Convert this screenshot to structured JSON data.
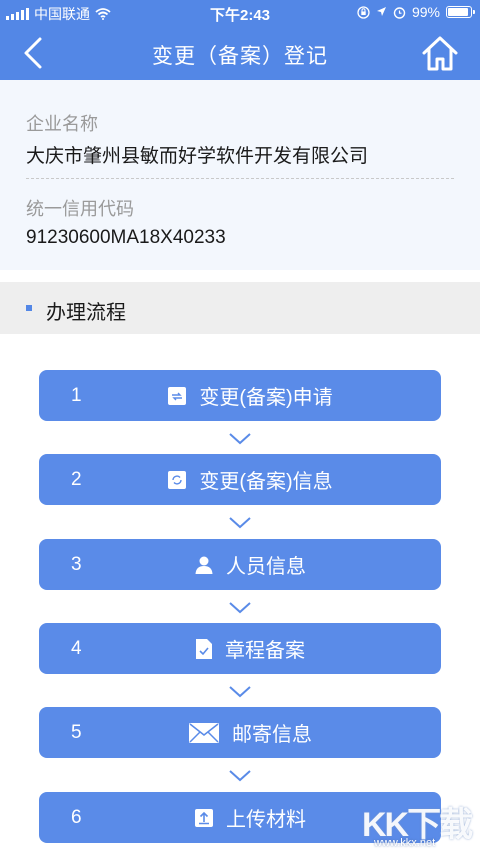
{
  "status_bar": {
    "carrier": "中国联通",
    "time": "下午2:43",
    "battery": "99%"
  },
  "nav": {
    "title": "变更（备案）登记",
    "back_icon": "chevron-left-icon",
    "home_icon": "home-icon"
  },
  "company": {
    "name_label": "企业名称",
    "name_value": "大庆市肇州县敏而好学软件开发有限公司",
    "code_label": "统一信用代码",
    "code_value": "91230600MA18X40233"
  },
  "process": {
    "title": "办理流程",
    "steps": [
      {
        "num": "1",
        "label": "变更(备案)申请",
        "icon": "form-icon"
      },
      {
        "num": "2",
        "label": "变更(备案)信息",
        "icon": "refresh-icon"
      },
      {
        "num": "3",
        "label": "人员信息",
        "icon": "person-icon"
      },
      {
        "num": "4",
        "label": "章程备案",
        "icon": "document-check-icon"
      },
      {
        "num": "5",
        "label": "邮寄信息",
        "icon": "mail-icon"
      },
      {
        "num": "6",
        "label": "上传材料",
        "icon": "upload-icon"
      }
    ]
  },
  "watermark": {
    "big": "KK下载",
    "small": "www.kkx.net"
  },
  "colors": {
    "primary": "#5387e6",
    "step_bg": "#5a8be8",
    "company_bg": "#f3f7fd",
    "section_bg": "#eeeeee"
  }
}
